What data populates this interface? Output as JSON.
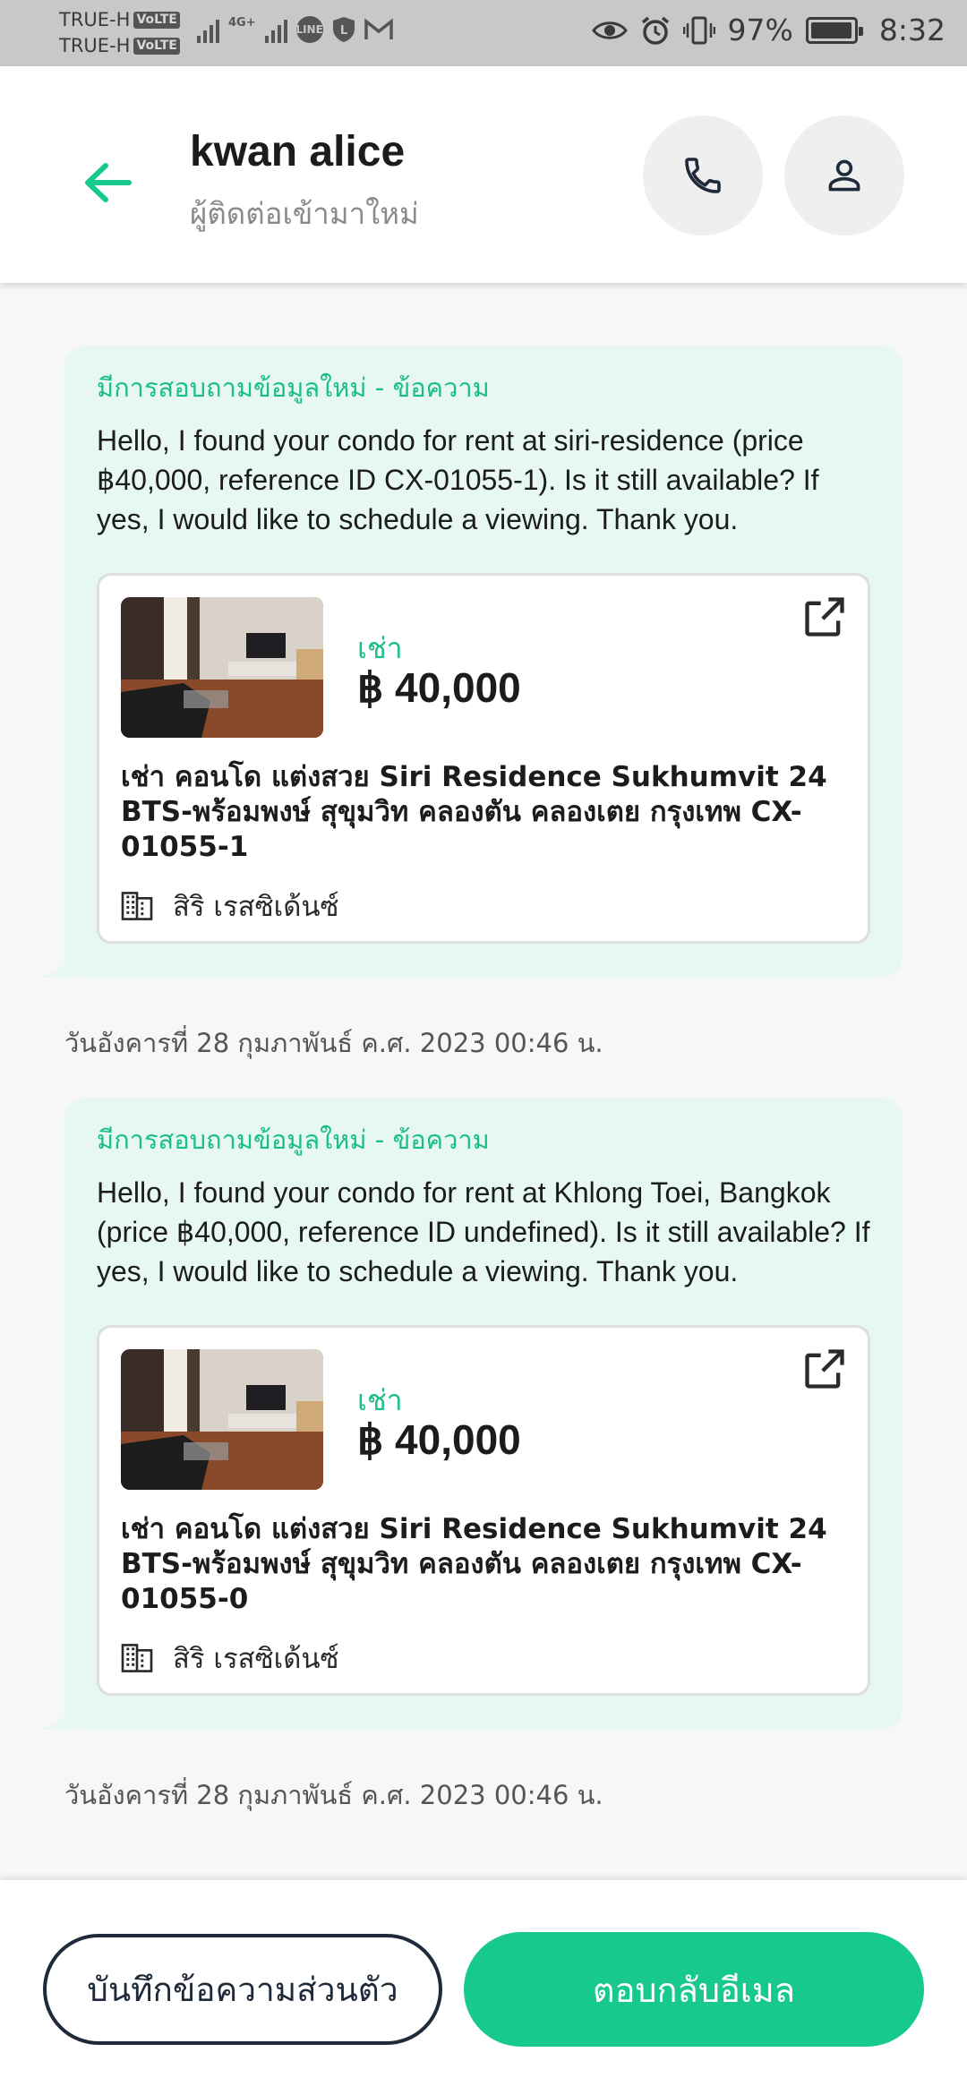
{
  "status_bar": {
    "carriers": [
      "TRUE-H",
      "TRUE-H"
    ],
    "volte_label": "VoLTE",
    "network": "4G+",
    "battery": "97%",
    "battery_level": 0.97,
    "time": "8:32"
  },
  "header": {
    "name": "kwan alice",
    "subtitle": "ผู้ติดต่อเข้ามาใหม่"
  },
  "messages": [
    {
      "title": "มีการสอบถามข้อมูลใหม่ - ข้อความ",
      "text": "Hello, I found your condo for rent at siri-residence (price ฿40,000, reference ID CX-01055-1). Is it still available? If yes, I would like to schedule a viewing. Thank you.",
      "listing": {
        "type": "เช่า",
        "price": "฿ 40,000",
        "title": "เช่า คอนโด แต่งสวย Siri Residence Sukhumvit 24 BTS-พร้อมพงษ์ สุขุมวิท คลองตัน คลองเตย กรุงเทพ CX-01055-1",
        "project": "สิริ เรสซิเด้นซ์"
      },
      "timestamp": "วันอังคารที่ 28 กุมภาพันธ์ ค.ศ. 2023 00:46 น."
    },
    {
      "title": "มีการสอบถามข้อมูลใหม่ - ข้อความ",
      "text": "Hello, I found your condo for rent at Khlong Toei, Bangkok (price ฿40,000, reference ID undefined). Is it still available? If yes, I would like to schedule a viewing. Thank you.",
      "listing": {
        "type": "เช่า",
        "price": "฿ 40,000",
        "title": "เช่า คอนโด แต่งสวย Siri Residence Sukhumvit 24 BTS-พร้อมพงษ์ สุขุมวิท คลองตัน คลองเตย กรุงเทพ CX-01055-0",
        "project": "สิริ เรสซิเด้นซ์"
      },
      "timestamp": "วันอังคารที่ 28 กุมภาพันธ์ ค.ศ. 2023 00:46 น."
    }
  ],
  "actions": {
    "save_note": "บันทึกข้อความส่วนตัว",
    "reply_email": "ตอบกลับอีเมล"
  },
  "colors": {
    "accent": "#17c98b",
    "bubble": "#e6f8f1",
    "dark": "#1e2a3a"
  },
  "icons": [
    "back-arrow-icon",
    "phone-icon",
    "person-icon",
    "external-link-icon",
    "building-icon",
    "eye-icon",
    "alarm-icon",
    "vibrate-icon",
    "battery-icon",
    "line-icon",
    "gmail-icon"
  ]
}
